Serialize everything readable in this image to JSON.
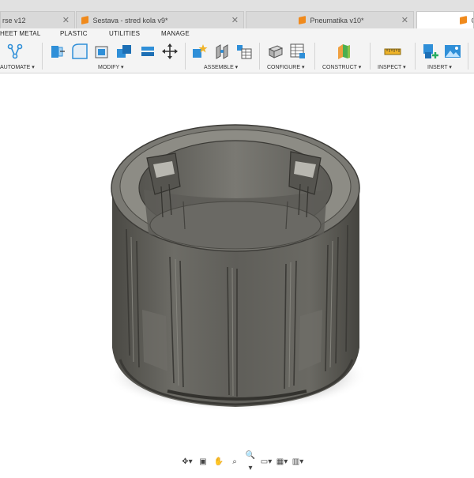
{
  "tabs": [
    {
      "title": "rse v12",
      "close": "✕"
    },
    {
      "title": "Sestava - stred kola v9*",
      "close": "✕"
    },
    {
      "title": "Pneumatika v10*",
      "close": "✕"
    },
    {
      "title": "C",
      "close": ""
    }
  ],
  "workspace_tabs": [
    "HEET METAL",
    "PLASTIC",
    "UTILITIES",
    "MANAGE"
  ],
  "toolbar": {
    "groups": [
      {
        "label": "AUTOMATE ▾"
      },
      {
        "label": "MODIFY ▾"
      },
      {
        "label": "ASSEMBLE ▾"
      },
      {
        "label": "CONFIGURE ▾"
      },
      {
        "label": "CONSTRUCT ▾"
      },
      {
        "label": "INSPECT ▾"
      },
      {
        "label": "INSERT ▾"
      }
    ]
  },
  "colors": {
    "accent_orange": "#f08a1c",
    "tool_blue": "#2f8fd8",
    "model_dark": "#4a4a46",
    "model_mid": "#6b6a64",
    "model_light": "#8c8b84"
  },
  "icons": {
    "automate": "automate-icon",
    "modify": [
      "press-pull-icon",
      "fillet-icon",
      "chamfer-icon",
      "combine-icon",
      "shell-icon",
      "move-icon"
    ],
    "assemble": [
      "new-component-icon",
      "joint-icon",
      "table-icon"
    ],
    "configure": [
      "configure-icon",
      "configure-table-icon"
    ],
    "construct": [
      "offset-plane-icon"
    ],
    "inspect": [
      "measure-icon"
    ],
    "insert": [
      "insert-derive-icon",
      "insert-image-icon"
    ],
    "nav": [
      "orbit-icon",
      "look-at-icon",
      "pan-icon",
      "zoom-window-icon",
      "zoom-icon",
      "display-icon",
      "grid-icon",
      "viewports-icon"
    ]
  },
  "navbar": {
    "buttons": [
      "✥▾",
      "▣",
      "✋",
      "⌕",
      "🔍▾",
      "▭▾",
      "▦▾",
      "▥▾"
    ]
  }
}
